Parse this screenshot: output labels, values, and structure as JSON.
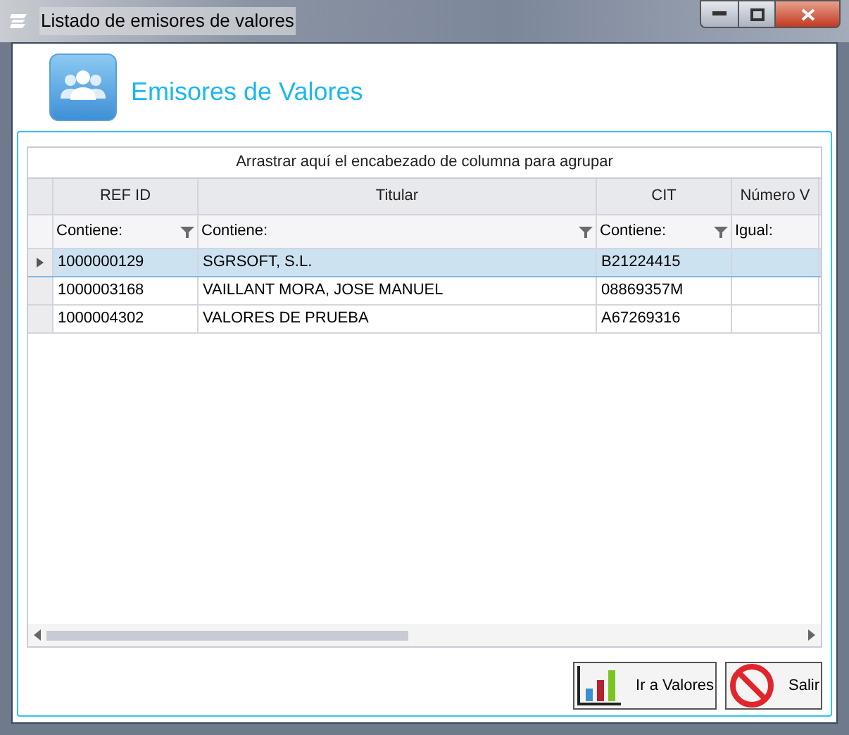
{
  "window": {
    "title": "Listado de emisores de valores"
  },
  "header": {
    "title": "Emisores de Valores"
  },
  "grid": {
    "group_panel": "Arrastrar aquí el encabezado de columna para agrupar",
    "columns": [
      {
        "header": "REF ID",
        "filter": "Contiene:",
        "filter_icon": true
      },
      {
        "header": "Titular",
        "filter": "Contiene:",
        "filter_icon": true
      },
      {
        "header": "CIT",
        "filter": "Contiene:",
        "filter_icon": true
      },
      {
        "header": "Número V",
        "filter": "Igual:",
        "filter_icon": false
      }
    ],
    "rows": [
      {
        "selected": true,
        "cells": [
          "1000000129",
          "SGRSOFT, S.L.",
          "B21224415",
          ""
        ]
      },
      {
        "selected": false,
        "cells": [
          "1000003168",
          "VAILLANT MORA, JOSE MANUEL",
          "08869357M",
          ""
        ]
      },
      {
        "selected": false,
        "cells": [
          "1000004302",
          "VALORES DE PRUEBA",
          "A67269316",
          ""
        ]
      }
    ]
  },
  "buttons": [
    {
      "kind": "chart",
      "label": "Ir a Valores"
    },
    {
      "kind": "stop",
      "label": "Salir"
    }
  ]
}
